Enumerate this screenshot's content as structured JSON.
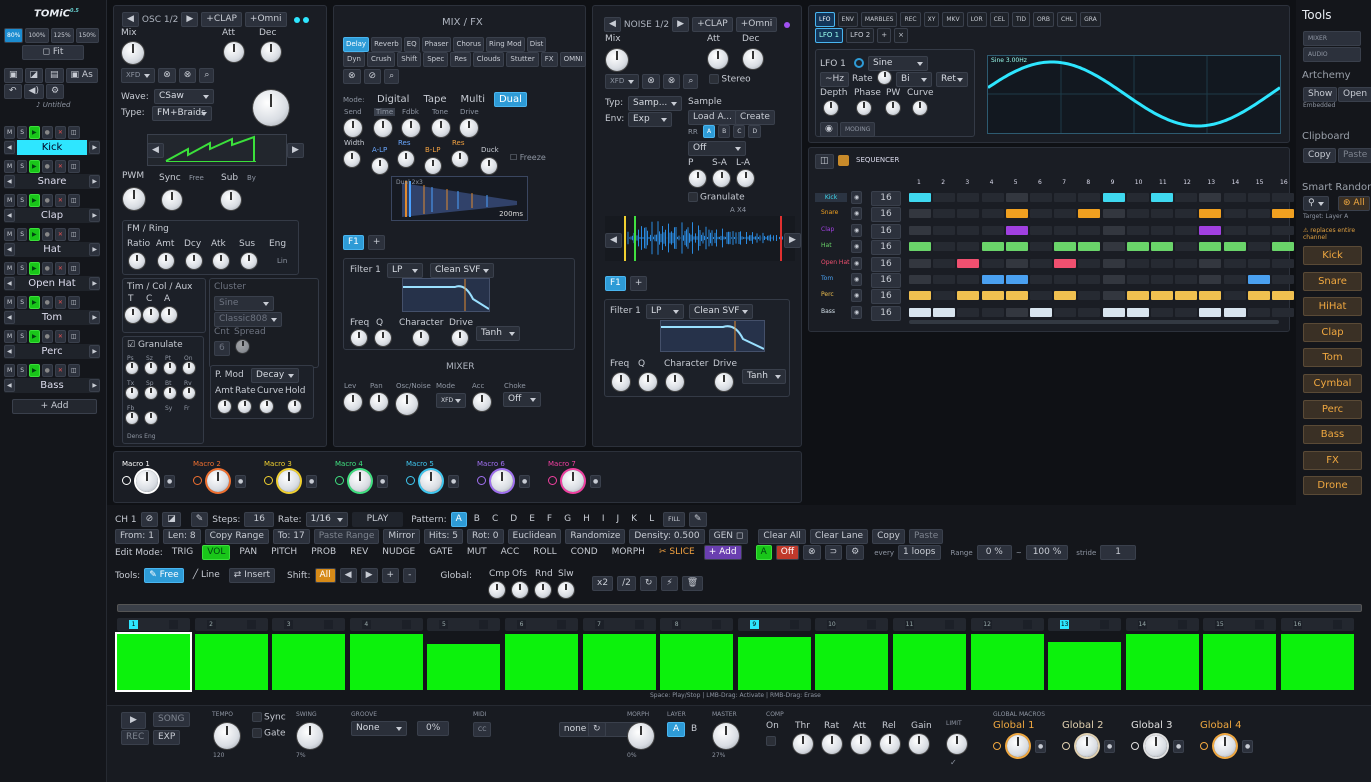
{
  "app": {
    "logo": "TOMiC",
    "version": "0.5",
    "zoom_options": [
      "80%",
      "100%",
      "125%",
      "150%"
    ],
    "fit": "Fit",
    "project": "Untitled",
    "as_label": "As",
    "add_label": "+ Add"
  },
  "tracks": [
    "Kick",
    "Snare",
    "Clap",
    "Hat",
    "Open Hat",
    "Tom",
    "Perc",
    "Bass"
  ],
  "osc": {
    "title": "OSC 1/2",
    "clap": "+CLAP",
    "omni": "+Omni",
    "mix": "Mix",
    "att": "Att",
    "dec": "Dec",
    "xfd": "XFD",
    "wave_label": "Wave:",
    "wave": "CSaw",
    "type_label": "Type:",
    "type": "FM+Braids",
    "pwm": "PWM",
    "sync": "Sync",
    "free": "Free",
    "sub": "Sub",
    "by": "By",
    "fm_title": "FM / Ring",
    "fm_labels": [
      "Ratio",
      "Amt",
      "Dcy",
      "Atk",
      "Sus",
      "Eng"
    ],
    "lin": "Lin",
    "tim_title": "Tim / Col / Aux",
    "tim_labels": [
      "T",
      "C",
      "A"
    ],
    "cluster": "Cluster",
    "sine": "Sine",
    "classic": "Classic808",
    "cnt": "Cnt",
    "spread": "Spread",
    "cnt_val": "6",
    "granulate": "Granulate",
    "gran_labels": [
      "Ps",
      "Sz",
      "Pt",
      "On",
      "Tx",
      "Sp",
      "Bt",
      "Rv",
      "Fb",
      "",
      "Sy",
      "Fr"
    ],
    "gran_sub": "Ons",
    "gran_eng": "Dens Eng",
    "pmod": "P. Mod",
    "pmod_sel": "Decay",
    "pmod_labels": [
      "Amt",
      "Rate",
      "Curve",
      "Hold"
    ]
  },
  "mixfx": {
    "title": "MIX / FX",
    "tabs1": [
      "Delay",
      "Reverb",
      "EQ",
      "Phaser",
      "Chorus",
      "Ring Mod",
      "Dist"
    ],
    "tabs2": [
      "Dyn",
      "Crush",
      "Shift",
      "Spec",
      "Res",
      "Clouds",
      "Stutter",
      "FX",
      "OMNI"
    ],
    "mode_label": "Mode:",
    "modes": [
      "Digital",
      "Tape",
      "Multi",
      "Dual"
    ],
    "knob_labels": [
      "Send",
      "Time",
      "Fdbk",
      "Tone",
      "Drive"
    ],
    "knob_labels2": [
      "Width",
      "A-LP",
      "Res",
      "B-LP",
      "Res",
      "Duck"
    ],
    "freeze": "Freeze",
    "delay_display": "200ms",
    "delay_tag": "Dual 2x3",
    "f1": "F1",
    "plus": "+",
    "filter": "Filter 1",
    "lp": "LP",
    "svf": "Clean SVF",
    "freq": "Freq",
    "q": "Q",
    "character": "Character",
    "drive": "Drive",
    "tanh": "Tanh",
    "mixer": "MIXER",
    "mixer_labels": [
      "Lev",
      "Pan",
      "Osc/Noise",
      "Mode",
      "Acc",
      "Choke"
    ],
    "xfd": "XFD",
    "off": "Off"
  },
  "noise": {
    "title": "NOISE 1/2",
    "clap": "+CLAP",
    "omni": "+Omni",
    "mix": "Mix",
    "att": "Att",
    "dec": "Dec",
    "xfd": "XFD",
    "stereo": "Stereo",
    "typ": "Typ:",
    "typ_val": "Samp...",
    "env": "Env:",
    "env_val": "Exp",
    "sample": "Sample",
    "load": "Load A...",
    "create": "Create",
    "rr": "RR",
    "rr_opts": [
      "A",
      "B",
      "C",
      "D"
    ],
    "off": "Off",
    "p": "P",
    "sa": "S-A",
    "la": "L-A",
    "granulate": "Granulate",
    "wave_tag": "A X4",
    "f1": "F1",
    "plus": "+",
    "filter": "Filter 1",
    "lp": "LP",
    "svf": "Clean SVF",
    "freq": "Freq",
    "q": "Q",
    "character": "Character",
    "drive": "Drive",
    "tanh": "Tanh"
  },
  "mod": {
    "tabs": [
      "LFO",
      "ENV",
      "MARBLES",
      "REC",
      "XY",
      "MKV",
      "LOR",
      "CEL",
      "TID",
      "ORB",
      "CHL",
      "GRA"
    ],
    "sub": [
      "LFO 1",
      "LFO 2",
      "+",
      "×"
    ],
    "lfo_title": "LFO 1",
    "shape": "Sine",
    "hz": "~Hz",
    "rate": "Rate",
    "bi": "Bi",
    "ret": "Ret",
    "depth": "Depth",
    "phase": "Phase",
    "pw": "PW",
    "curve": "Curve",
    "moding": "MODING",
    "display": "Sine 3.00Hz"
  },
  "seq": {
    "title": "SEQUENCER",
    "tracks": [
      {
        "name": "Kick",
        "len": "16",
        "color": "#3fd9f0",
        "steps": [
          1,
          0,
          0,
          0,
          0,
          0,
          0,
          0,
          1,
          0,
          1,
          0,
          0,
          0,
          0,
          0
        ]
      },
      {
        "name": "Snare",
        "len": "16",
        "color": "#f0a020",
        "steps": [
          0,
          0,
          0,
          0,
          1,
          0,
          0,
          1,
          0,
          0,
          0,
          0,
          1,
          0,
          0,
          1
        ]
      },
      {
        "name": "Clap",
        "len": "16",
        "color": "#a040e0",
        "steps": [
          0,
          0,
          0,
          0,
          1,
          0,
          0,
          0,
          0,
          0,
          0,
          0,
          1,
          0,
          0,
          0
        ]
      },
      {
        "name": "Hat",
        "len": "16",
        "color": "#6ad46a",
        "steps": [
          1,
          0,
          0,
          1,
          1,
          0,
          1,
          1,
          0,
          1,
          1,
          0,
          1,
          1,
          0,
          1
        ]
      },
      {
        "name": "Open Hat",
        "len": "16",
        "color": "#f05070",
        "steps": [
          0,
          0,
          1,
          0,
          0,
          0,
          1,
          0,
          0,
          0,
          0,
          0,
          0,
          0,
          0,
          0
        ]
      },
      {
        "name": "Tom",
        "len": "16",
        "color": "#4aa0f0",
        "steps": [
          0,
          0,
          0,
          1,
          1,
          0,
          0,
          0,
          0,
          0,
          0,
          0,
          0,
          0,
          1,
          0
        ]
      },
      {
        "name": "Perc",
        "len": "16",
        "color": "#f0c050",
        "steps": [
          1,
          0,
          1,
          1,
          1,
          0,
          1,
          0,
          0,
          1,
          1,
          1,
          1,
          0,
          1,
          1
        ]
      },
      {
        "name": "Bass",
        "len": "16",
        "color": "#d8e4ee",
        "steps": [
          1,
          1,
          0,
          0,
          0,
          1,
          0,
          0,
          1,
          1,
          0,
          0,
          1,
          1,
          0,
          0
        ]
      }
    ]
  },
  "side": {
    "tools": "Tools",
    "mixer": "MIXER",
    "audio": "AUDIO",
    "artchemy": "Artchemy",
    "show": "Show",
    "open": "Open",
    "embedded": "Embedded",
    "clipboard": "Clipboard",
    "copy": "Copy",
    "paste": "Paste",
    "smart": "Smart Random",
    "all": "All",
    "target": "Target: Layer A",
    "replaces": "replaces entire channel",
    "buttons": [
      "Kick",
      "Snare",
      "HiHat",
      "Clap",
      "Tom",
      "Cymbal",
      "Perc",
      "Bass",
      "FX",
      "Drone"
    ]
  },
  "macros": [
    {
      "name": "Macro 1",
      "color": "#ffffff"
    },
    {
      "name": "Macro 2",
      "color": "#f07030"
    },
    {
      "name": "Macro 3",
      "color": "#f0d030"
    },
    {
      "name": "Macro 4",
      "color": "#40e080"
    },
    {
      "name": "Macro 5",
      "color": "#40c8f0"
    },
    {
      "name": "Macro 6",
      "color": "#a070f0"
    },
    {
      "name": "Macro 7",
      "color": "#f040a0"
    }
  ],
  "edit": {
    "ch": "CH 1",
    "steps_label": "Steps:",
    "steps": "16",
    "rate_label": "Rate:",
    "rate": "1/16",
    "play": "PLAY",
    "pattern_label": "Pattern:",
    "patterns": [
      "A",
      "B",
      "C",
      "D",
      "E",
      "F",
      "G",
      "H",
      "I",
      "J",
      "K",
      "L"
    ],
    "fill": "FILL",
    "from": "From: 1",
    "len": "Len: 8",
    "copyrange": "Copy Range",
    "to": "To: 17",
    "pasterange": "Paste Range",
    "mirror": "Mirror",
    "hits": "Hits: 5",
    "rot": "Rot: 0",
    "euclid": "Euclidean",
    "randomize": "Randomize",
    "density": "Density: 0.500",
    "gen": "GEN",
    "clearall": "Clear All",
    "clearlane": "Clear Lane",
    "copy": "Copy",
    "paste": "Paste",
    "mode_label": "Edit Mode:",
    "modes": [
      "TRIG",
      "VOL",
      "PAN",
      "PITCH",
      "PROB",
      "REV",
      "NUDGE",
      "GATE",
      "MUT",
      "ACC",
      "ROLL",
      "COND",
      "MORPH",
      "SLICE",
      "+ Add"
    ],
    "a": "A",
    "off": "Off",
    "every": "every",
    "loops": "1 loops",
    "range": "Range",
    "r1": "0 %",
    "r2": "100 %",
    "stride": "stride",
    "stride_v": "1",
    "tools": "Tools:",
    "free": "Free",
    "line": "Line",
    "insert": "Insert",
    "shift": "Shift:",
    "all": "All",
    "global": "Global:",
    "glabels": [
      "Cmp",
      "Ofs",
      "Rnd",
      "Slw"
    ],
    "x2": "x2",
    "d2": "/2",
    "hint": "Space: Play/Stop | LMB-Drag: Activate | RMB-Drag: Erase"
  },
  "pads": {
    "heights": [
      1,
      1,
      1,
      1,
      0.83,
      1,
      1,
      1,
      0.95,
      1,
      1,
      1,
      0.85,
      1,
      1,
      1
    ],
    "active": [
      1,
      9,
      13
    ]
  },
  "transport": {
    "song": "SONG",
    "rec": "REC",
    "exp": "EXP",
    "tempo": "TEMPO",
    "tempo_v": "120",
    "sync": "Sync",
    "gate": "Gate",
    "swing": "SWING",
    "swing_v": "7%",
    "groove": "GROOVE",
    "groove_v": "None",
    "groove_pct": "0%",
    "midi": "MIDI",
    "cc": "CC",
    "midi_v": "none",
    "morph": "MORPH",
    "morph_v": "0%",
    "layer": "LAYER",
    "la": "A",
    "lb": "B",
    "master": "MASTER",
    "master_v": "27%",
    "comp": "COMP",
    "comp_labels": [
      "On",
      "Thr",
      "Rat",
      "Att",
      "Rel",
      "Gain"
    ],
    "limit": "LIMIT",
    "gm": "GLOBAL MACROS",
    "globals": [
      {
        "name": "Global 1",
        "color": "#f0a840"
      },
      {
        "name": "Global 2",
        "color": "#e0d0b0"
      },
      {
        "name": "Global 3",
        "color": "#e0e0e0"
      },
      {
        "name": "Global 4",
        "color": "#f0a840"
      }
    ]
  }
}
